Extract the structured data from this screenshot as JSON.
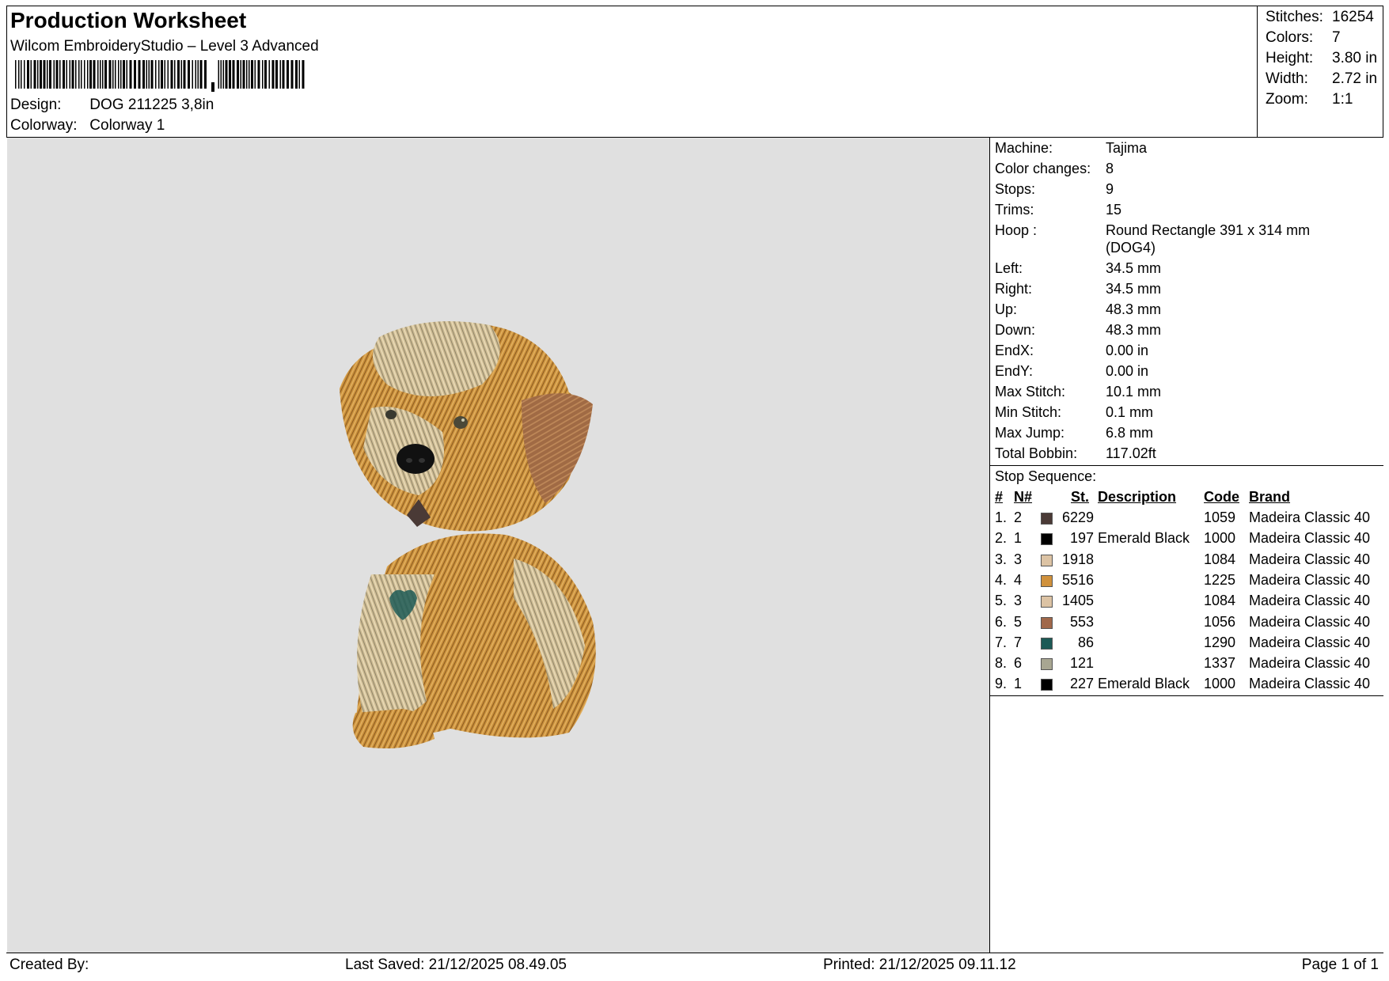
{
  "header": {
    "title": "Production Worksheet",
    "subtitle": "Wilcom EmbroideryStudio – Level 3 Advanced",
    "design_label": "Design:",
    "design_value": "DOG 211225 3,8in",
    "colorway_label": "Colorway:",
    "colorway_value": "Colorway 1"
  },
  "stats": {
    "stitches_label": "Stitches:",
    "stitches_value": "16254",
    "colors_label": "Colors:",
    "colors_value": "7",
    "height_label": "Height:",
    "height_value": "3.80 in",
    "width_label": "Width:",
    "width_value": "2.72 in",
    "zoom_label": "Zoom:",
    "zoom_value": "1:1"
  },
  "info": {
    "machine_label": "Machine:",
    "machine_value": "Tajima",
    "color_changes_label": "Color changes:",
    "color_changes_value": "8",
    "stops_label": "Stops:",
    "stops_value": "9",
    "trims_label": "Trims:",
    "trims_value": "15",
    "hoop_label": "Hoop :",
    "hoop_value": "Round Rectangle 391 x 314 mm (DOG4)",
    "left_label": "Left:",
    "left_value": "34.5 mm",
    "right_label": "Right:",
    "right_value": "34.5 mm",
    "up_label": "Up:",
    "up_value": "48.3 mm",
    "down_label": "Down:",
    "down_value": "48.3 mm",
    "endx_label": "EndX:",
    "endx_value": "0.00 in",
    "endy_label": "EndY:",
    "endy_value": "0.00 in",
    "max_stitch_label": "Max Stitch:",
    "max_stitch_value": "10.1 mm",
    "min_stitch_label": "Min Stitch:",
    "min_stitch_value": "0.1 mm",
    "max_jump_label": "Max Jump:",
    "max_jump_value": "6.8 mm",
    "total_bobbin_label": "Total Bobbin:",
    "total_bobbin_value": "117.02ft"
  },
  "sequence": {
    "title": "Stop Sequence:",
    "headers": {
      "num": "#",
      "n": "N#",
      "st": "St.",
      "desc": "Description",
      "code": "Code",
      "brand": "Brand"
    },
    "rows": [
      {
        "num": "1.",
        "n": "2",
        "color": "#4a3a36",
        "st": "6229",
        "desc": "",
        "code": "1059",
        "brand": "Madeira Classic 40"
      },
      {
        "num": "2.",
        "n": "1",
        "color": "#000000",
        "st": "197",
        "desc": "Emerald Black",
        "code": "1000",
        "brand": "Madeira Classic 40"
      },
      {
        "num": "3.",
        "n": "3",
        "color": "#dcc3a4",
        "st": "1918",
        "desc": "",
        "code": "1084",
        "brand": "Madeira Classic 40"
      },
      {
        "num": "4.",
        "n": "4",
        "color": "#d0913c",
        "st": "5516",
        "desc": "",
        "code": "1225",
        "brand": "Madeira Classic 40"
      },
      {
        "num": "5.",
        "n": "3",
        "color": "#dcc3a4",
        "st": "1405",
        "desc": "",
        "code": "1084",
        "brand": "Madeira Classic 40"
      },
      {
        "num": "6.",
        "n": "5",
        "color": "#a0684a",
        "st": "553",
        "desc": "",
        "code": "1056",
        "brand": "Madeira Classic 40"
      },
      {
        "num": "7.",
        "n": "7",
        "color": "#1d5a56",
        "st": "86",
        "desc": "",
        "code": "1290",
        "brand": "Madeira Classic 40"
      },
      {
        "num": "8.",
        "n": "6",
        "color": "#a8a692",
        "st": "121",
        "desc": "",
        "code": "1337",
        "brand": "Madeira Classic 40"
      },
      {
        "num": "9.",
        "n": "1",
        "color": "#000000",
        "st": "227",
        "desc": "Emerald Black",
        "code": "1000",
        "brand": "Madeira Classic 40"
      }
    ]
  },
  "footer": {
    "created_by": "Created By:",
    "last_saved": "Last Saved: 21/12/2025 08.49.05",
    "printed": "Printed: 21/12/2025 09.11.12",
    "page": "Page 1 of 1"
  }
}
